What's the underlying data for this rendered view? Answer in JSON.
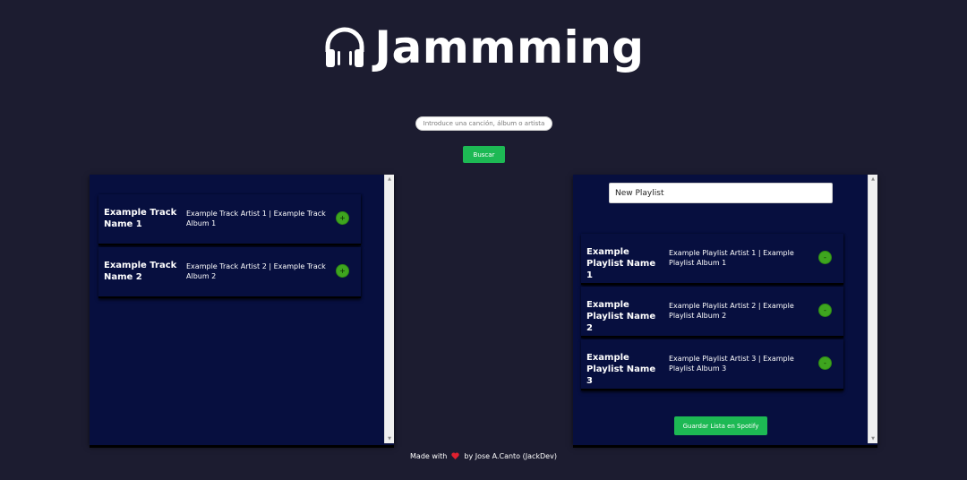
{
  "app": {
    "title": "Jammming",
    "logo_icon": "headphones-icon"
  },
  "search": {
    "placeholder": "Introduce una canción, álbum o artista",
    "value": "",
    "button_label": "Buscar"
  },
  "results": {
    "tracks": [
      {
        "name": "Example Track Name 1",
        "info": "Example Track Artist 1 | Example Track Album 1",
        "action": "+"
      },
      {
        "name": "Example Track Name 2",
        "info": "Example Track Artist 2 | Example Track Album 2",
        "action": "+"
      }
    ]
  },
  "playlist": {
    "name_value": "New Playlist",
    "tracks": [
      {
        "name": "Example Playlist Name 1",
        "info": "Example Playlist Artist 1 | Example Playlist Album 1",
        "action": "-"
      },
      {
        "name": "Example Playlist Name 2",
        "info": "Example Playlist Artist 2 | Example Playlist Album 2",
        "action": "-"
      },
      {
        "name": "Example Playlist Name 3",
        "info": "Example Playlist Artist 3 | Example Playlist Album 3",
        "action": "-"
      }
    ],
    "save_label": "Guardar Lista en Spotify"
  },
  "footer": {
    "made_with": "Made with",
    "heart_icon": "heart-icon",
    "by": "by Jose A.Canto (JackDev)"
  },
  "colors": {
    "background": "#1c1c30",
    "panel": "#070f3f",
    "accent_green": "#1db954",
    "track_button": "#3ea51f",
    "heart": "#e0202f"
  }
}
